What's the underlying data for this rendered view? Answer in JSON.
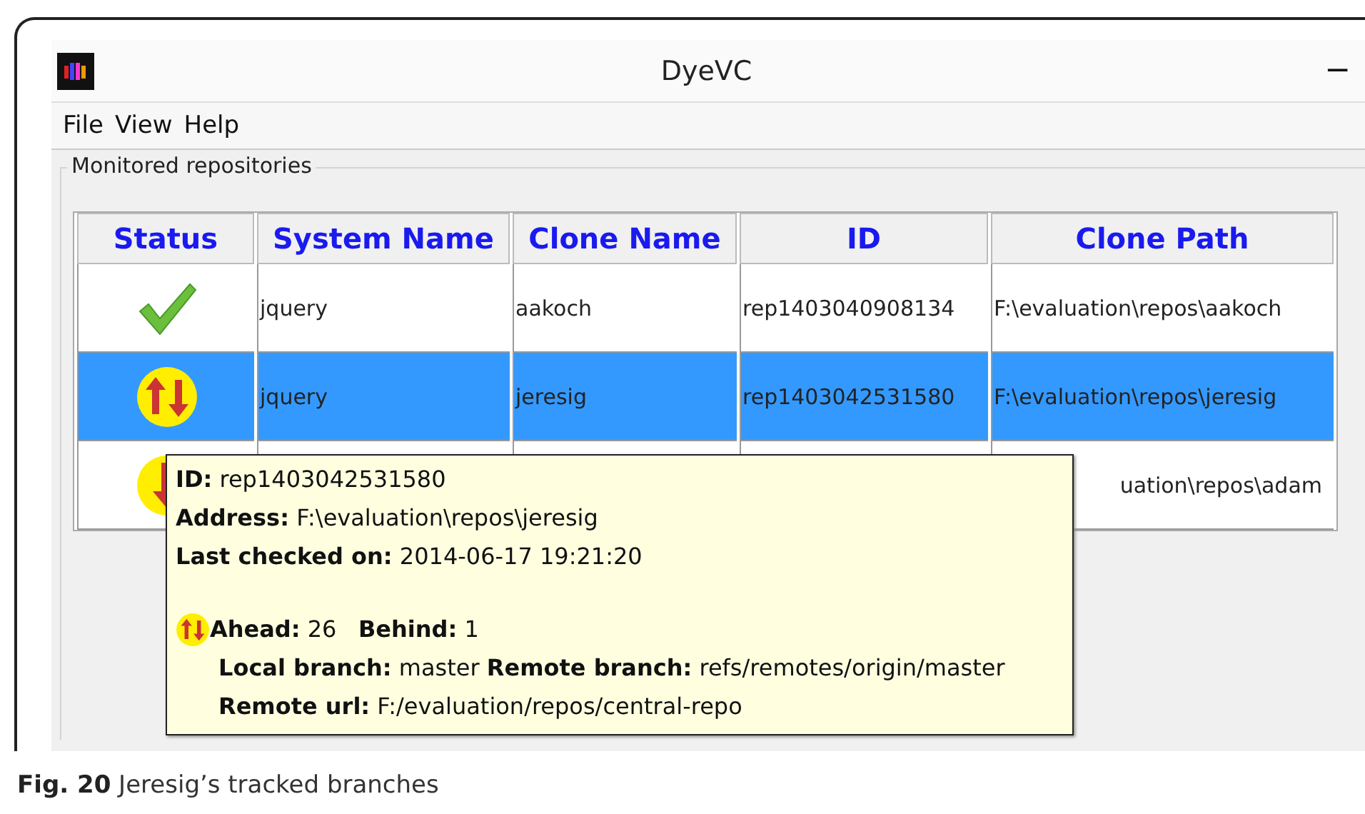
{
  "window": {
    "title": "DyeVC",
    "minimize": "−"
  },
  "menu": [
    {
      "label": "File"
    },
    {
      "label": "View"
    },
    {
      "label": "Help"
    }
  ],
  "group": {
    "title": "Monitored repositories"
  },
  "table": {
    "columns": [
      "Status",
      "System Name",
      "Clone Name",
      "ID",
      "Clone Path"
    ],
    "rows": [
      {
        "kind": "ok",
        "selected": false,
        "system_name": "jquery",
        "clone_name": "aakoch",
        "id": "rep1403040908134",
        "clone_path": "F:\\evaluation\\repos\\aakoch"
      },
      {
        "kind": "ahead_behind",
        "selected": true,
        "system_name": "jquery",
        "clone_name": "jeresig",
        "id": "rep1403042531580",
        "clone_path": "F:\\evaluation\\repos\\jeresig"
      },
      {
        "kind": "behind",
        "selected": false,
        "clone_path": "uation\\repos\\adam"
      }
    ]
  },
  "tooltip": {
    "lines": [
      "**ID:** rep1403042531580",
      "**Address:** F:\\evaluation\\repos\\jeresig",
      "**Last checked on:** 2014-06-17 19:21:20"
    ],
    "status": {
      "kind": "ahead_behind",
      "line": "**Ahead:** 26   **Behind:** 1"
    },
    "details": [
      "**Local branch:** master **Remote branch:** refs/remotes/origin/master",
      "**Remote url:** F:/evaluation/repos/central-repo"
    ]
  },
  "caption": "**Fig. 20** Jeresig’s tracked branches"
}
